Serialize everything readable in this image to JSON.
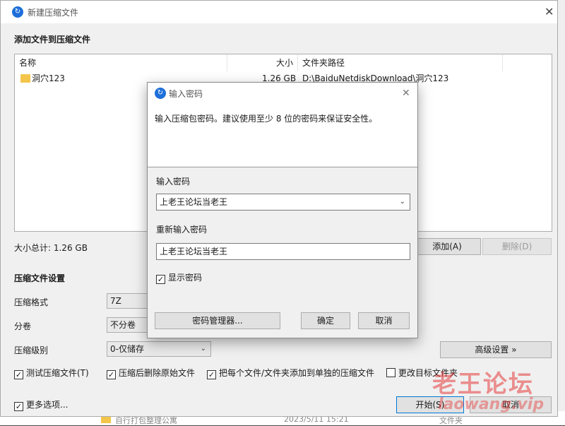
{
  "main": {
    "title": "新建压缩文件",
    "section_add": "添加文件到压缩文件",
    "columns": [
      "名称",
      "大小",
      "文件夹路径"
    ],
    "files": [
      {
        "name": "洞穴123",
        "size": "1.26 GB",
        "path": "D:\\BaiduNetdiskDownload\\洞穴123"
      }
    ],
    "total_label": "大小总计: 1.26 GB",
    "add_button": "添加(A)",
    "delete_button": "删除(D)",
    "settings_title": "压缩文件设置",
    "format_label": "压缩格式",
    "format_value": "7Z",
    "split_label": "分卷",
    "split_value": "不分卷",
    "level_label": "压缩级别",
    "level_value": "0-仅储存",
    "advanced_button": "高级设置 »",
    "checkbox_test": "测试压缩文件(T)",
    "checkbox_delete": "压缩后删除原始文件",
    "checkbox_each": "把每个文件/文件夹添加到单独的压缩文件",
    "checkbox_change": "更改目标文件夹",
    "checkbox_more": "更多选项...",
    "start_button": "开始(S)",
    "cancel_button": "取消"
  },
  "password": {
    "title": "输入密码",
    "description": "输入压缩包密码。建议使用至少 8 位的密码来保证安全性。",
    "enter_label": "输入密码",
    "enter_value": "上老王论坛当老王",
    "reenter_label": "重新输入密码",
    "reenter_value": "上老王论坛当老王",
    "show_password": "显示密码",
    "manager_button": "密码管理器...",
    "ok_button": "确定",
    "cancel_button": "取消"
  },
  "background": {
    "row_name": "自行打包整理公寓",
    "row_date": "2023/5/11 15:21",
    "row_type": "文件夹"
  },
  "watermark": {
    "text": "老王论坛",
    "url": "laowang.vip"
  },
  "colors": {
    "accent": "#1e6fd9",
    "folder": "#f3c64b",
    "dialog_bg": "#f0f0f0"
  }
}
